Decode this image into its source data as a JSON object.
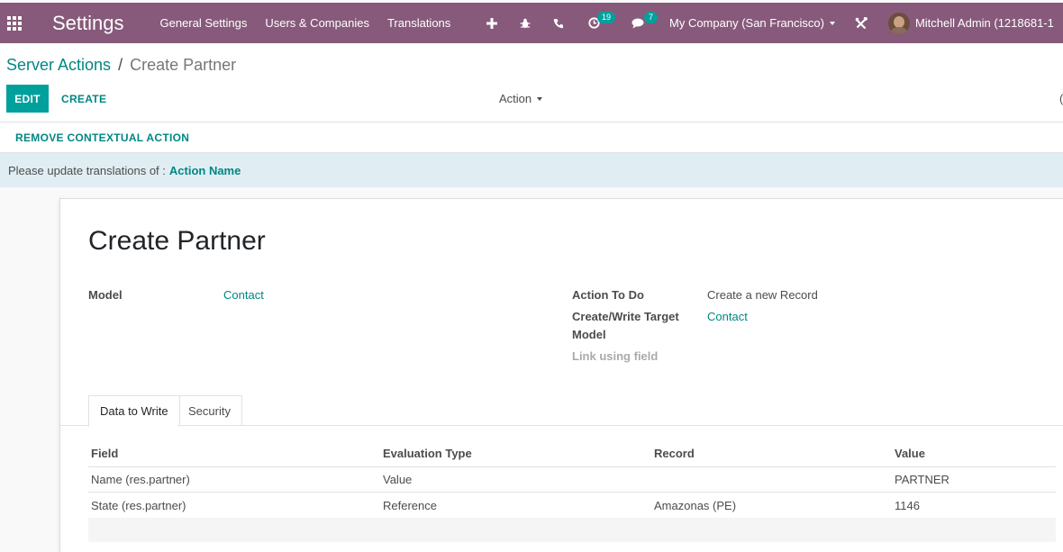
{
  "navbar": {
    "brand": "Settings",
    "menu": [
      "General Settings",
      "Users & Companies",
      "Translations"
    ],
    "activity_count": "19",
    "message_count": "7",
    "company": "My Company (San Francisco)",
    "user": "Mitchell Admin (1218681-1",
    "colors": {
      "bar": "#875a7b",
      "badge": "#00a09d"
    }
  },
  "breadcrumb": {
    "parent": "Server Actions",
    "separator": "/",
    "current": "Create Partner"
  },
  "toolbar": {
    "edit_label": "EDIT",
    "create_label": "CREATE",
    "action_label": "Action",
    "edge_text": "("
  },
  "button_box": {
    "remove_label": "REMOVE CONTEXTUAL ACTION"
  },
  "alert": {
    "text": "Please update translations of :",
    "field": "Action Name"
  },
  "form": {
    "title": "Create Partner",
    "model_label": "Model",
    "model_value": "Contact",
    "action_label": "Action To Do",
    "action_value": "Create a new Record",
    "target_label_1": "Create/Write Target",
    "target_label_2": "Model",
    "target_value": "Contact",
    "link_field_label": "Link using field"
  },
  "tabs": [
    {
      "label": "Data to Write",
      "active": true
    },
    {
      "label": "Security",
      "active": false
    }
  ],
  "table": {
    "headers": [
      "Field",
      "Evaluation Type",
      "Record",
      "Value"
    ],
    "rows": [
      [
        "Name (res.partner)",
        "Value",
        "",
        "PARTNER"
      ],
      [
        "State (res.partner)",
        "Reference",
        "Amazonas (PE)",
        "1146"
      ]
    ]
  }
}
